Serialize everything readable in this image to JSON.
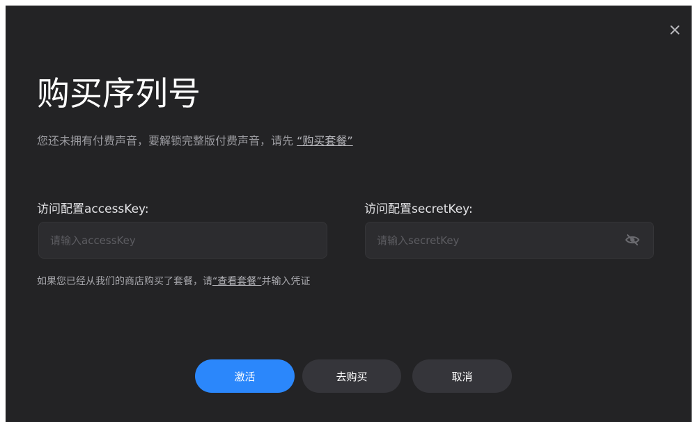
{
  "dialog": {
    "title": "购买序列号",
    "subtitle_text": "您还未拥有付费声音，要解锁完整版付费声音，请先 ",
    "subtitle_link": "“购买套餐”",
    "close_icon": "close-icon"
  },
  "form": {
    "access_key": {
      "label": "访问配置accessKey:",
      "value": "",
      "placeholder": "请输入accessKey"
    },
    "secret_key": {
      "label": "访问配置secretKey:",
      "value": "",
      "placeholder": "请输入secretKey",
      "toggle_icon": "eye-slash-icon"
    },
    "hint_prefix": "如果您已经从我们的商店购买了套餐，请",
    "hint_link": "“查看套餐”",
    "hint_suffix": "并输入凭证"
  },
  "actions": {
    "activate_label": "激活",
    "buy_label": "去购买",
    "cancel_label": "取消"
  },
  "colors": {
    "dialog_background": "#232325",
    "primary_button": "#2b87fb",
    "secondary_button": "#35353a",
    "input_background": "#2c2c2f"
  }
}
